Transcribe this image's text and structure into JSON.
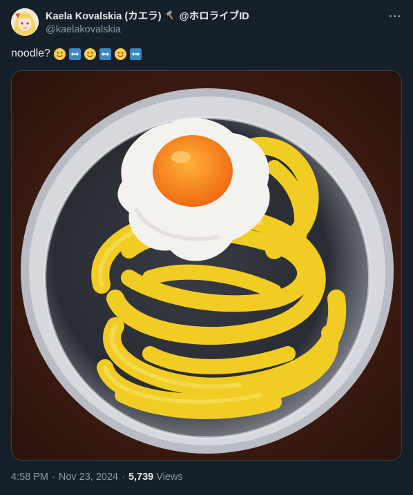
{
  "author": {
    "display_name": "Kaela Kovalskia (カエラ)",
    "affiliation": "@ホロライブID",
    "handle": "@kaelakovalskia",
    "avatar_icon": "avatar-illustration",
    "badge_icon": "hammer-icon"
  },
  "tweet": {
    "text": "noodle?",
    "emojis": [
      "slightly-smiling-face",
      "left-right-arrow",
      "slightly-smiling-face",
      "left-right-arrow",
      "slightly-smiling-face",
      "left-right-arrow"
    ]
  },
  "media": {
    "description_icon": "photo"
  },
  "meta": {
    "time": "4:58 PM",
    "separator": "·",
    "date": "Nov 23, 2024",
    "views_count": "5,739",
    "views_label": "Views"
  },
  "colors": {
    "background": "#15202b",
    "text_primary": "#e7e9ea",
    "text_secondary": "#8b98a5"
  }
}
